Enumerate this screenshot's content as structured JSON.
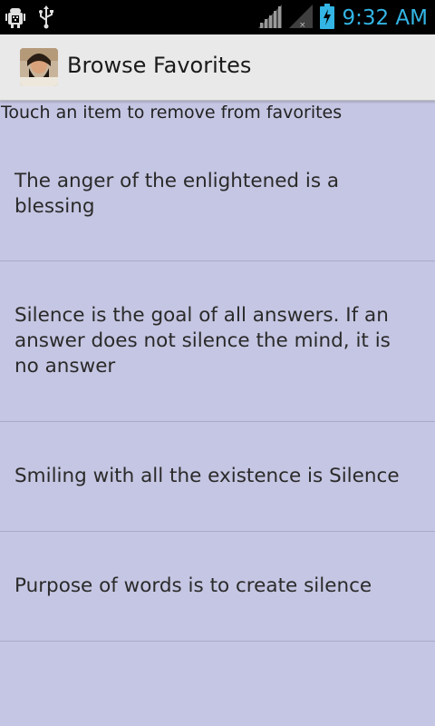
{
  "status_bar": {
    "time": "9:32 AM",
    "icons": [
      "android-debug-icon",
      "usb-icon",
      "signal-icon",
      "signal-no-data-icon",
      "battery-charging-icon"
    ]
  },
  "action_bar": {
    "title": "Browse Favorites",
    "app_icon": "avatar-icon"
  },
  "hint": "Touch an item to remove from favorites",
  "list": {
    "items": [
      {
        "text": "The anger of the enlightened is a blessing"
      },
      {
        "text": "Silence is the goal of all answers. If an answer does not silence the mind, it is no answer"
      },
      {
        "text": "Smiling with all the existence is Silence"
      },
      {
        "text": "Purpose of words is to create silence"
      }
    ]
  },
  "colors": {
    "background": "#c5c6e3",
    "status_accent": "#33b5e5",
    "action_bar": "#e9e9e9"
  }
}
